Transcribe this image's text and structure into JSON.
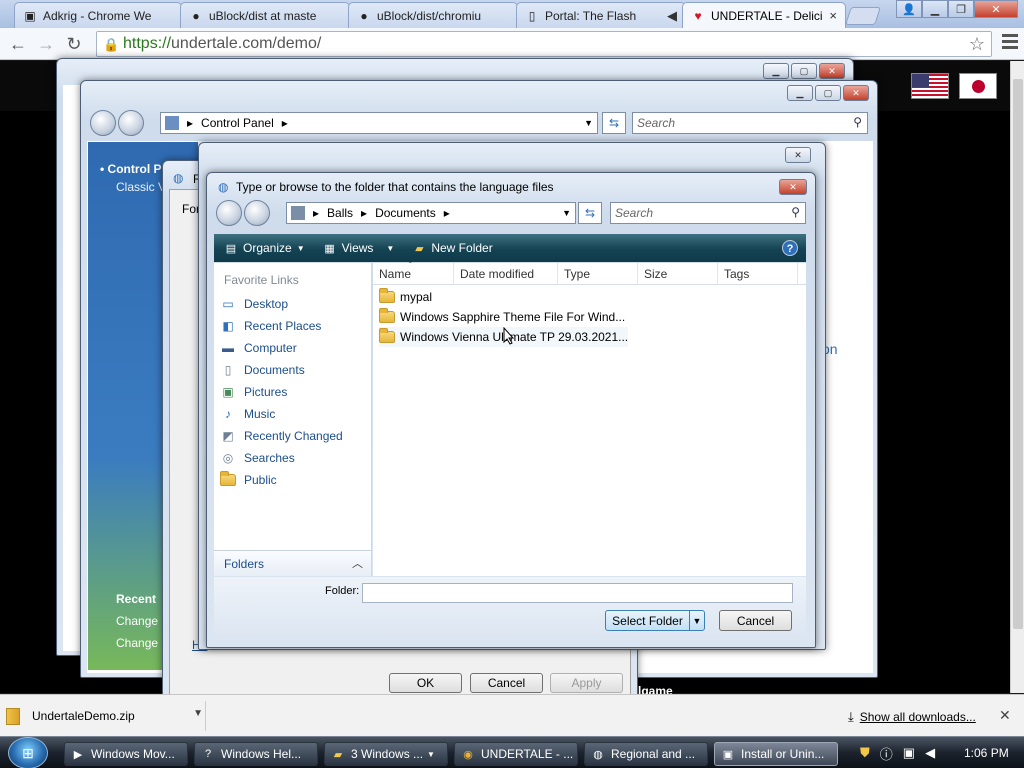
{
  "browser": {
    "tabs": [
      {
        "label": "Adkrig - Chrome We",
        "icon": "picture-icon"
      },
      {
        "label": "uBlock/dist at maste",
        "icon": "github-icon"
      },
      {
        "label": "uBlock/dist/chromiu",
        "icon": "github-icon"
      },
      {
        "label": "Portal: The Flash",
        "icon": "page-icon"
      },
      {
        "label": "UNDERTALE - Delici",
        "icon": "heart-icon"
      }
    ],
    "close_glyph": "×",
    "url_scheme": "https://",
    "url_rest": "undertale.com/demo/"
  },
  "control_panel": {
    "breadcrumb": "Control Panel",
    "search_placeholder": "Search",
    "side_title": "Control P",
    "side_sub": "Classic V",
    "recent": "Recent",
    "change1": "Change",
    "change2": "Change",
    "link_fragment": "on"
  },
  "region_dialog": {
    "title": "R",
    "tab": "For",
    "link": "Ho",
    "ok": "OK",
    "cancel": "Cancel",
    "apply": "Apply",
    "behind_text": "lgame"
  },
  "folder_dialog": {
    "title": "Type or browse to the folder that contains the language files",
    "breadcrumb": [
      "Balls",
      "Documents"
    ],
    "search_placeholder": "Search",
    "commands": {
      "organize": "Organize",
      "views": "Views",
      "new_folder": "New Folder"
    },
    "favorite_links_header": "Favorite Links",
    "favorite_links": [
      {
        "label": "Desktop",
        "icon": "desktop-icon"
      },
      {
        "label": "Recent Places",
        "icon": "recent-places-icon"
      },
      {
        "label": "Computer",
        "icon": "computer-icon"
      },
      {
        "label": "Documents",
        "icon": "documents-icon"
      },
      {
        "label": "Pictures",
        "icon": "pictures-icon"
      },
      {
        "label": "Music",
        "icon": "music-icon"
      },
      {
        "label": "Recently Changed",
        "icon": "recently-changed-icon"
      },
      {
        "label": "Searches",
        "icon": "searches-icon"
      },
      {
        "label": "Public",
        "icon": "folder-icon"
      }
    ],
    "folders_label": "Folders",
    "columns": [
      "Name",
      "Date modified",
      "Type",
      "Size",
      "Tags"
    ],
    "files": [
      "mypal",
      "Windows Sapphire Theme File For Wind...",
      "Windows Vienna Ultimate TP 29.03.2021..."
    ],
    "folder_label": "Folder:",
    "folder_value": "",
    "select_button": "Select Folder",
    "cancel_button": "Cancel"
  },
  "downloads": {
    "file": "UndertaleDemo.zip",
    "show_all": "Show all downloads..."
  },
  "taskbar": {
    "items": [
      {
        "label": "Windows Mov...",
        "icon": "movie-icon"
      },
      {
        "label": "Windows Hel...",
        "icon": "help-icon"
      },
      {
        "label": "3 Windows ...",
        "icon": "folder-icon"
      },
      {
        "label": "UNDERTALE - ...",
        "icon": "chrome-icon"
      },
      {
        "label": "Regional and ...",
        "icon": "globe-icon"
      },
      {
        "label": "Install or Unin...",
        "icon": "installer-icon"
      }
    ],
    "clock": "1:06 PM"
  }
}
